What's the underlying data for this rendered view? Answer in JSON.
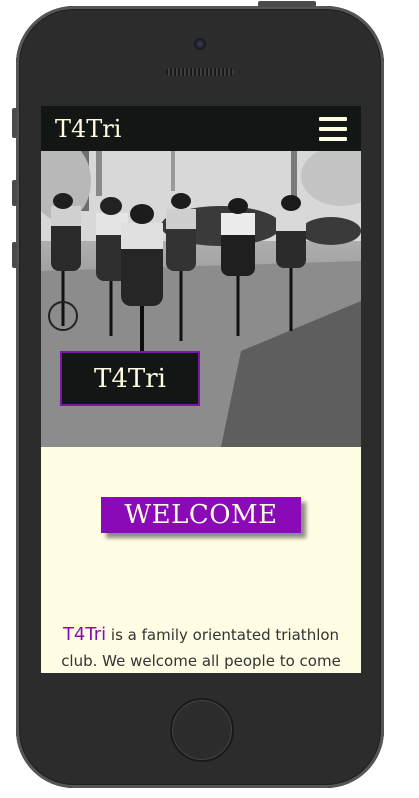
{
  "navbar": {
    "brand": "T4Tri",
    "menu_icon": "hamburger-icon"
  },
  "hero": {
    "badge_text": "T4Tri"
  },
  "welcome": {
    "heading": "WELCOME"
  },
  "intro": {
    "club_name": "T4Tri",
    "text": " is a family orientated triathlon club. We welcome all people to come and enjoy the fun of swim"
  },
  "colors": {
    "accent": "#8a0ab8",
    "nav_bg": "#121614",
    "page_bg": "#fffde3"
  }
}
